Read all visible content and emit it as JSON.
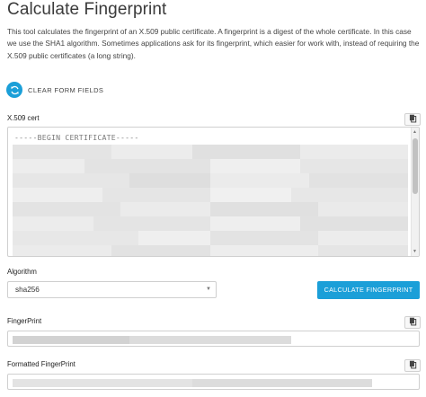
{
  "page": {
    "title": "Calculate Fingerprint",
    "description": "This tool calculates the fingerprint of an X.509 public certificate. A fingerprint is a digest of the whole certificate. In this case we use the SHA1 algorithm. Sometimes applications ask for its fingerprint, which easier for work with, instead of requiring the X.509 public certificates (a long string)."
  },
  "actions": {
    "clear_label": "CLEAR FORM FIELDS",
    "calculate_label": "CALCULATE FINGERPRINT"
  },
  "cert": {
    "label": "X.509 cert",
    "first_line": "-----BEGIN CERTIFICATE-----"
  },
  "algorithm": {
    "label": "Algorithm",
    "selected": "sha256"
  },
  "fingerprint": {
    "label": "FingerPrint"
  },
  "formatted": {
    "label": "Formatted FingerPrint"
  },
  "colors": {
    "accent": "#1b9fd8"
  },
  "icons": {
    "clear": "refresh-icon",
    "copy": "copy-icon",
    "dropdown": "chevron-down-icon"
  }
}
